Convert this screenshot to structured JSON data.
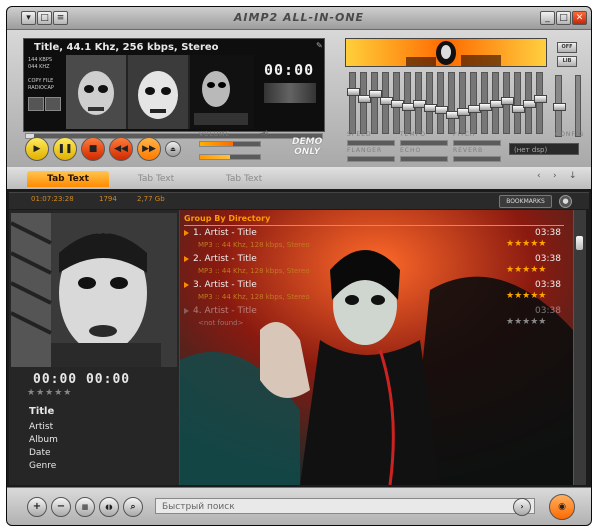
{
  "window": {
    "title": "AIMP2 ALL-IN-ONE"
  },
  "player": {
    "track_info": "Title, 44.1 Khz, 256 kbps, Stereo",
    "display_time": "00:00",
    "info_lines": [
      "144 KBPS",
      "044 KHZ",
      "",
      "COPY FILE",
      "RADIOCAP"
    ],
    "demo_text": "DEMO\nONLY",
    "dsp_value": "(нет dsp)",
    "volume_level": 0.55,
    "balance_level": 0.5,
    "labels": {
      "volume": "VOLUME",
      "speed": "SPEED",
      "tempo": "TEMPO",
      "pitch": "PITCH",
      "flanger": "FLANGER",
      "echo": "ECHO",
      "reverb": "REVERB",
      "config": "CONFIG",
      "off": "OFF",
      "lib": "LIB"
    },
    "controls": [
      "play-icon",
      "pause-icon",
      "stop-icon",
      "prev-icon",
      "next-icon",
      "eject-icon"
    ]
  },
  "equalizer": {
    "bands": [
      0.72,
      0.6,
      0.68,
      0.55,
      0.5,
      0.45,
      0.5,
      0.42,
      0.38,
      0.3,
      0.35,
      0.4,
      0.45,
      0.5,
      0.55,
      0.4,
      0.5,
      0.6
    ],
    "preamp": 0.5
  },
  "tabs": [
    "Tab Text",
    "Tab Text",
    "Tab Text"
  ],
  "tab_nav": {
    "left": "‹",
    "right": "›",
    "down": "↓"
  },
  "summary": {
    "duration": "01:07:23:28",
    "count": "1794",
    "size": "2,77 Gb",
    "bookmarks_label": "BOOKMARKS"
  },
  "now_playing": {
    "timer": "00:00   00:00",
    "stars": "★★★★★",
    "title": "Title",
    "artist": "Artist",
    "album": "Album",
    "date": "Date",
    "genre": "Genre"
  },
  "playlist": {
    "group_label": "Group By Directory",
    "items": [
      {
        "title": "1. Artist - Title",
        "time": "03:38",
        "meta": "MP3 :: 44 Khz, 128 kbps, Stereo",
        "stars": "★★★★★"
      },
      {
        "title": "2. Artist - Title",
        "time": "03:38",
        "meta": "MP3 :: 44 Khz, 128 kbps, Stereo",
        "stars": "★★★★★"
      },
      {
        "title": "3. Artist - Title",
        "time": "03:38",
        "meta": "MP3 :: 44 Khz, 128 kbps, Stereo",
        "stars": "★★★★★"
      },
      {
        "title": "4. Artist - Title",
        "time": "03:38",
        "meta": "<not found>",
        "stars": "★★★★★"
      }
    ]
  },
  "bottom": {
    "search_placeholder": "Быстрый поиск",
    "buttons": [
      "add-icon",
      "remove-icon",
      "sort-icon",
      "shuffle-icon",
      "search-icon"
    ]
  }
}
